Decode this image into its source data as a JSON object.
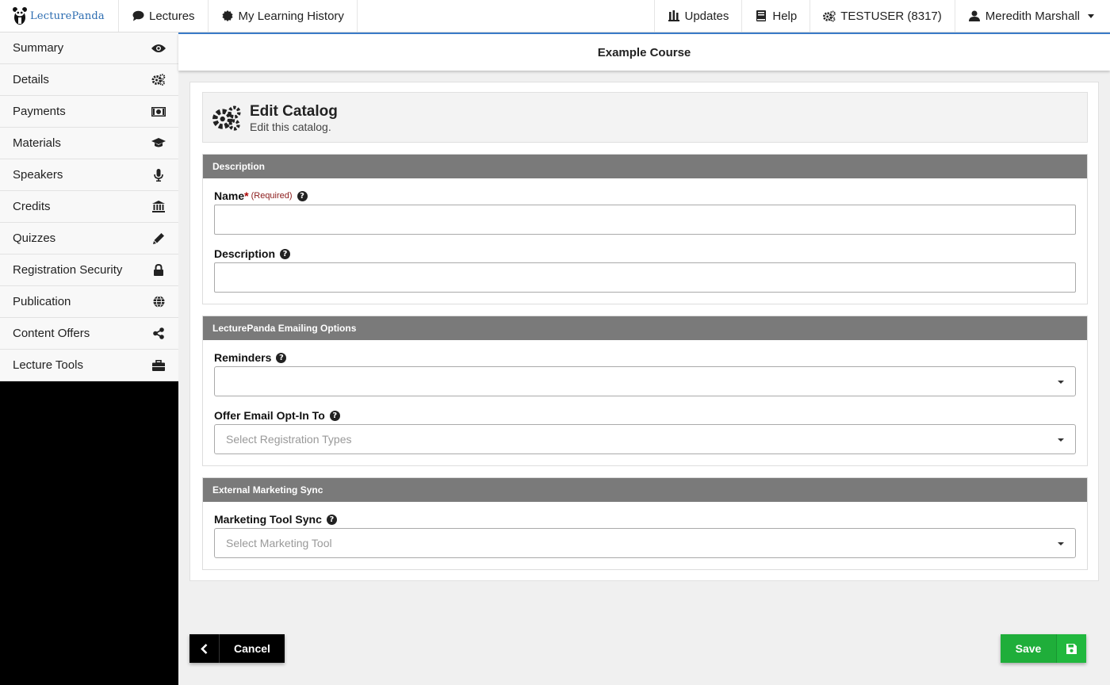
{
  "brand": {
    "name": "LecturePanda"
  },
  "topnav": {
    "left": [
      {
        "label": "Lectures",
        "icon": "chat-bubble-icon"
      },
      {
        "label": "My Learning History",
        "icon": "badge-icon"
      }
    ],
    "right": [
      {
        "label": "Updates",
        "icon": "updates-icon"
      },
      {
        "label": "Help",
        "icon": "book-icon"
      },
      {
        "label": "TESTUSER (8317)",
        "icon": "gears-icon"
      },
      {
        "label": "Meredith Marshall",
        "icon": "user-icon"
      }
    ]
  },
  "sidebar": {
    "items": [
      {
        "label": "Summary",
        "icon": "eye-icon"
      },
      {
        "label": "Details",
        "icon": "gears-icon"
      },
      {
        "label": "Payments",
        "icon": "money-icon"
      },
      {
        "label": "Materials",
        "icon": "graduation-cap-icon"
      },
      {
        "label": "Speakers",
        "icon": "microphone-icon"
      },
      {
        "label": "Credits",
        "icon": "institution-icon"
      },
      {
        "label": "Quizzes",
        "icon": "pencil-icon"
      },
      {
        "label": "Registration Security",
        "icon": "lock-icon"
      },
      {
        "label": "Publication",
        "icon": "globe-icon"
      },
      {
        "label": "Content Offers",
        "icon": "share-icon"
      },
      {
        "label": "Lecture Tools",
        "icon": "briefcase-icon"
      }
    ]
  },
  "course": {
    "title": "Example Course"
  },
  "edit": {
    "title": "Edit Catalog",
    "subtitle": "Edit this catalog."
  },
  "sections": {
    "description": {
      "heading": "Description",
      "name_label": "Name",
      "required_mark": "*",
      "required_note": "(Required)",
      "name_value": "",
      "description_label": "Description",
      "description_value": ""
    },
    "emailing": {
      "heading": "LecturePanda Emailing Options",
      "reminders_label": "Reminders",
      "reminders_value": "",
      "optin_label": "Offer Email Opt-In To",
      "optin_placeholder": "Select Registration Types"
    },
    "marketing": {
      "heading": "External Marketing Sync",
      "sync_label": "Marketing Tool Sync",
      "sync_placeholder": "Select Marketing Tool"
    }
  },
  "footer": {
    "cancel_label": "Cancel",
    "save_label": "Save"
  },
  "colors": {
    "accent": "#3a7bc8",
    "save": "#1fae3a",
    "section_header": "#7a7a7a",
    "required": "#8b1a1a"
  }
}
